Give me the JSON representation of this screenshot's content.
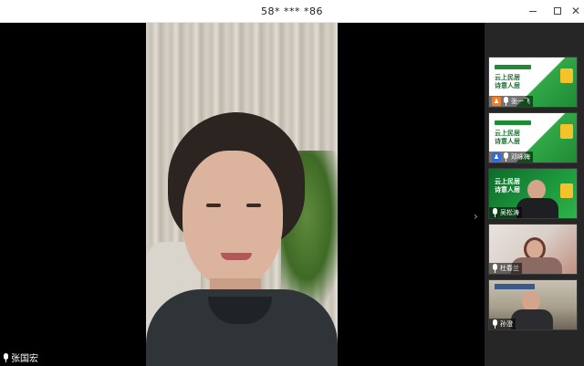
{
  "window": {
    "title": "58* *** *86"
  },
  "main_video": {
    "speaker_name": "张国宏"
  },
  "participants": [
    {
      "name": "张一飞",
      "role": "host",
      "poster_title_1": "云上民居",
      "poster_title_2": "诗意人居"
    },
    {
      "name": "邓咏梅",
      "role": "cohost",
      "poster_title_1": "云上民居",
      "poster_title_2": "诗意人居"
    },
    {
      "name": "吴松涛",
      "role": "participant",
      "poster_title_1": "云上民居",
      "poster_title_2": "诗意人居"
    },
    {
      "name": "杜春兰",
      "role": "participant"
    },
    {
      "name": "孙澄",
      "role": "participant"
    }
  ],
  "colors": {
    "background": "#000000",
    "sidebar": "#262626",
    "poster_green": "#1f8a36",
    "host_badge": "#ff7a1a",
    "cohost_badge": "#2d6cdf"
  },
  "icons": [
    "minimize-icon",
    "maximize-icon",
    "close-icon",
    "microphone-icon",
    "chevron-right-icon"
  ]
}
